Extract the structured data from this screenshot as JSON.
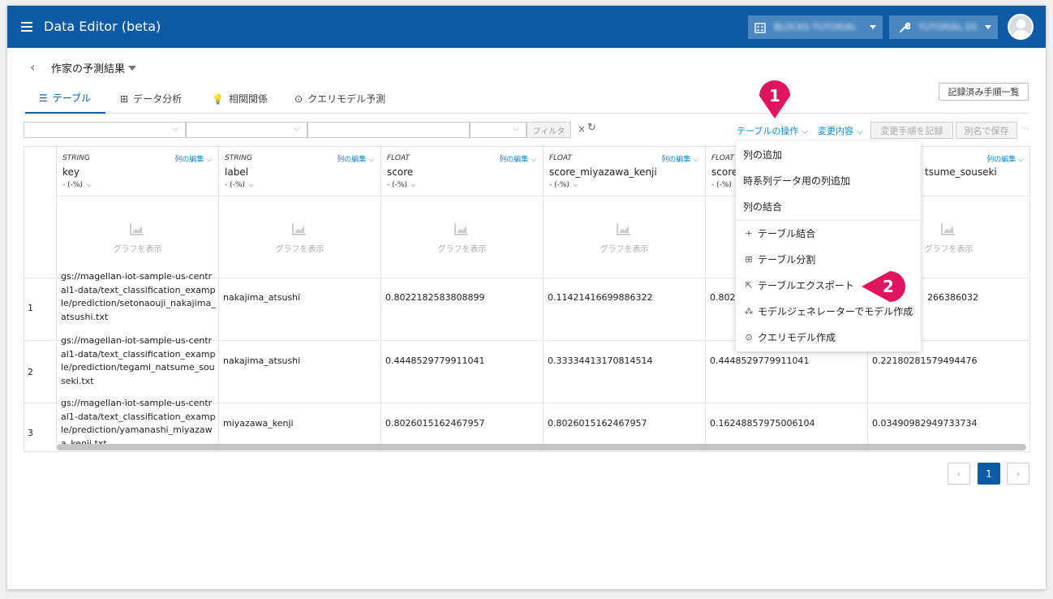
{
  "app": {
    "title": "Data Editor (beta)",
    "workspace_blurred": "BLOCKS TUTORIAL",
    "project_blurred": "TUTORIAL 03"
  },
  "page": {
    "title": "作家の予測結果"
  },
  "tabs": [
    {
      "label": "テーブル",
      "icon": "table-icon"
    },
    {
      "label": "データ分析",
      "icon": "plus-box-icon"
    },
    {
      "label": "相関関係",
      "icon": "lightbulb-icon"
    },
    {
      "label": "クエリモデル予測",
      "icon": "query-icon"
    }
  ],
  "history_button": "記録済み手順一覧",
  "filter": {
    "apply": "フィルタ",
    "clear": "×"
  },
  "toolbar": {
    "table_ops": "テーブルの操作",
    "changes": "変更内容",
    "record_steps": "変更手順を記録",
    "save_as": "別名で保存",
    "more": "···"
  },
  "columns": [
    {
      "type": "STRING",
      "name": "key",
      "edit": "列の編集",
      "pct": "- (-%)"
    },
    {
      "type": "STRING",
      "name": "label",
      "edit": "列の編集",
      "pct": "- (-%)"
    },
    {
      "type": "FLOAT",
      "name": "score",
      "edit": "列の編集",
      "pct": "- (-%)"
    },
    {
      "type": "FLOAT",
      "name": "score_miyazawa_kenji",
      "edit": "列の編集",
      "pct": "- (-%)"
    },
    {
      "type": "FLOAT",
      "name": "score_",
      "edit": "列の編集",
      "pct": "- (-%)"
    },
    {
      "type": "",
      "name": "tsume_souseki",
      "edit": "列の編集",
      "pct": ""
    }
  ],
  "graph_label": "グラフを表示",
  "rows": [
    {
      "num": "1",
      "cells": [
        "gs://magellan-iot-sample-us-central1-data/text_classification_example/prediction/setonaouji_nakajima_atsushi.txt",
        "nakajima_atsushi",
        "0.8022182583808899",
        "0.11421416699886322",
        "0.8022",
        "266386032"
      ]
    },
    {
      "num": "2",
      "cells": [
        "gs://magellan-iot-sample-us-central1-data/text_classification_example/prediction/tegami_natsume_souseki.txt",
        "nakajima_atsushi",
        "0.4448529779911041",
        "0.33334413170814514",
        "0.4448529779911041",
        "0.22180281579494476"
      ]
    },
    {
      "num": "3",
      "cells": [
        "gs://magellan-iot-sample-us-central1-data/text_classification_example/prediction/yamanashi_miyazawa_kenji.txt",
        "miyazawa_kenji",
        "0.8026015162467957",
        "0.8026015162467957",
        "0.16248857975006104",
        "0.03490982949733734"
      ]
    }
  ],
  "menu": [
    {
      "label": "列の追加",
      "icon": ""
    },
    {
      "label": "時系列データ用の列追加",
      "icon": ""
    },
    {
      "label": "列の結合",
      "icon": ""
    },
    {
      "label": "テーブル結合",
      "icon": "plus-icon"
    },
    {
      "label": "テーブル分割",
      "icon": "grid-icon"
    },
    {
      "label": "テーブルエクスポート",
      "icon": "export-icon"
    },
    {
      "label": "モデルジェネレーターでモデル作成",
      "icon": "model-generator-icon"
    },
    {
      "label": "クエリモデル作成",
      "icon": "query-icon"
    }
  ],
  "callouts": [
    "1",
    "2"
  ],
  "pagination": {
    "prev": "‹",
    "current": "1",
    "next": "›"
  },
  "colors": {
    "appbar": "#0a5aa6",
    "accent": "#0a8ad0",
    "callout": "#e0135e"
  }
}
